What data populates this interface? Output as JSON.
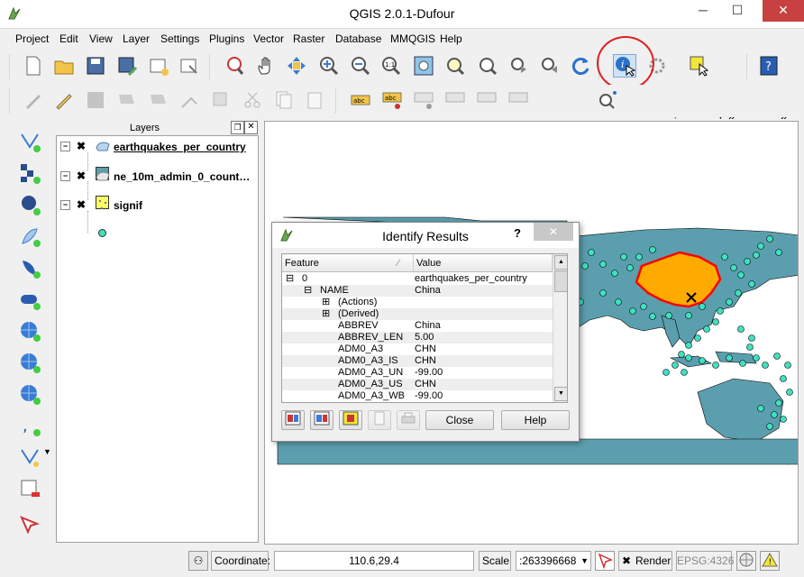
{
  "window": {
    "title": "QGIS 2.0.1-Dufour",
    "minimize": "─",
    "maximize": "☐",
    "close": "✕"
  },
  "menu": [
    "Project",
    "Edit",
    "View",
    "Layer",
    "Settings",
    "Plugins",
    "Vector",
    "Raster",
    "Database",
    "MMQGIS",
    "Help"
  ],
  "toolbar": {
    "overflow": "»"
  },
  "layers": {
    "title": "Layers",
    "items": [
      {
        "name": "earthquakes_per_country",
        "checked": "✖",
        "swatch": "#5b9fae"
      },
      {
        "name": "ne_10m_admin_0_count…",
        "checked": "✖",
        "swatch": "#ffff66"
      },
      {
        "name": "signif",
        "checked": "✖",
        "swatch": "#40e0c0"
      }
    ]
  },
  "dialog": {
    "title": "Identify Results",
    "help_mark": "?",
    "columns": [
      "Feature",
      "Value"
    ],
    "rows": [
      {
        "feature": "0",
        "value": "earthquakes_per_country"
      },
      {
        "feature": "NAME",
        "value": "China"
      },
      {
        "feature": "(Actions)",
        "value": ""
      },
      {
        "feature": "(Derived)",
        "value": ""
      },
      {
        "feature": "ABBREV",
        "value": "China"
      },
      {
        "feature": "ABBREV_LEN",
        "value": "5.00"
      },
      {
        "feature": "ADM0_A3",
        "value": "CHN"
      },
      {
        "feature": "ADM0_A3_IS",
        "value": "CHN"
      },
      {
        "feature": "ADM0_A3_UN",
        "value": "-99.00"
      },
      {
        "feature": "ADM0_A3_US",
        "value": "CHN"
      },
      {
        "feature": "ADM0_A3_WB",
        "value": "-99.00"
      }
    ],
    "close_label": "Close",
    "help_label": "Help"
  },
  "status": {
    "coordinate_label": "Coordinate:",
    "coordinate_value": "110.6,29.4",
    "scale_label": "Scale",
    "scale_value": ":263396668",
    "render_label": "Render",
    "render_checked": "✖",
    "crs": "EPSG:4326"
  },
  "colors": {
    "highlight": "#ffaa00",
    "highlight_border": "#ff0000",
    "countries": "#5b9fae",
    "quakes": "#40e0c0",
    "annotation_circle": "#e02020"
  }
}
